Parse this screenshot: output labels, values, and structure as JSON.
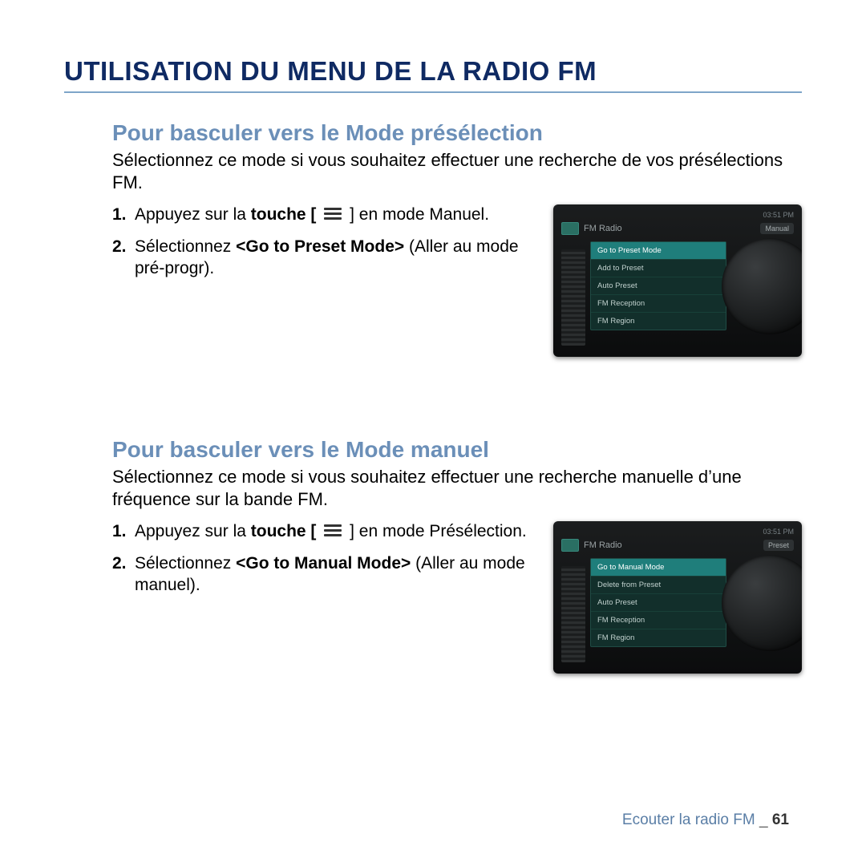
{
  "page_title": "UTILISATION DU MENU DE LA RADIO FM",
  "footer": {
    "chapter": "Ecouter la radio FM",
    "separator": "_",
    "page": "61"
  },
  "section1": {
    "title": "Pour basculer vers le Mode présélection",
    "desc": "Sélectionnez ce mode si vous souhaitez effectuer une recherche de vos présélections FM.",
    "steps": [
      {
        "num": "1.",
        "before": "Appuyez sur la ",
        "bold": "touche [",
        "after": " ] en mode Manuel."
      },
      {
        "num": "2.",
        "before": "Sélectionnez ",
        "bold": "<Go to Preset Mode>",
        "after": " (Aller au mode pré-progr)."
      }
    ]
  },
  "section2": {
    "title": "Pour basculer vers le Mode manuel",
    "desc": "Sélectionnez ce mode si vous souhaitez effectuer une recherche manuelle d’une fréquence sur la bande FM.",
    "steps": [
      {
        "num": "1.",
        "before": "Appuyez sur la ",
        "bold": "touche [",
        "after": " ] en mode Présélection."
      },
      {
        "num": "2.",
        "before": "Sélectionnez ",
        "bold": "<Go to Manual Mode>",
        "after": " (Aller au mode manuel)."
      }
    ]
  },
  "device1": {
    "time": "03:51 PM",
    "app": "FM Radio",
    "mode": "Manual",
    "menu": [
      "Go to Preset Mode",
      "Add to Preset",
      "Auto Preset",
      "FM Reception",
      "FM Region"
    ]
  },
  "device2": {
    "time": "03:51 PM",
    "app": "FM Radio",
    "mode": "Preset",
    "menu": [
      "Go to Manual Mode",
      "Delete from Preset",
      "Auto Preset",
      "FM Reception",
      "FM Region"
    ]
  }
}
